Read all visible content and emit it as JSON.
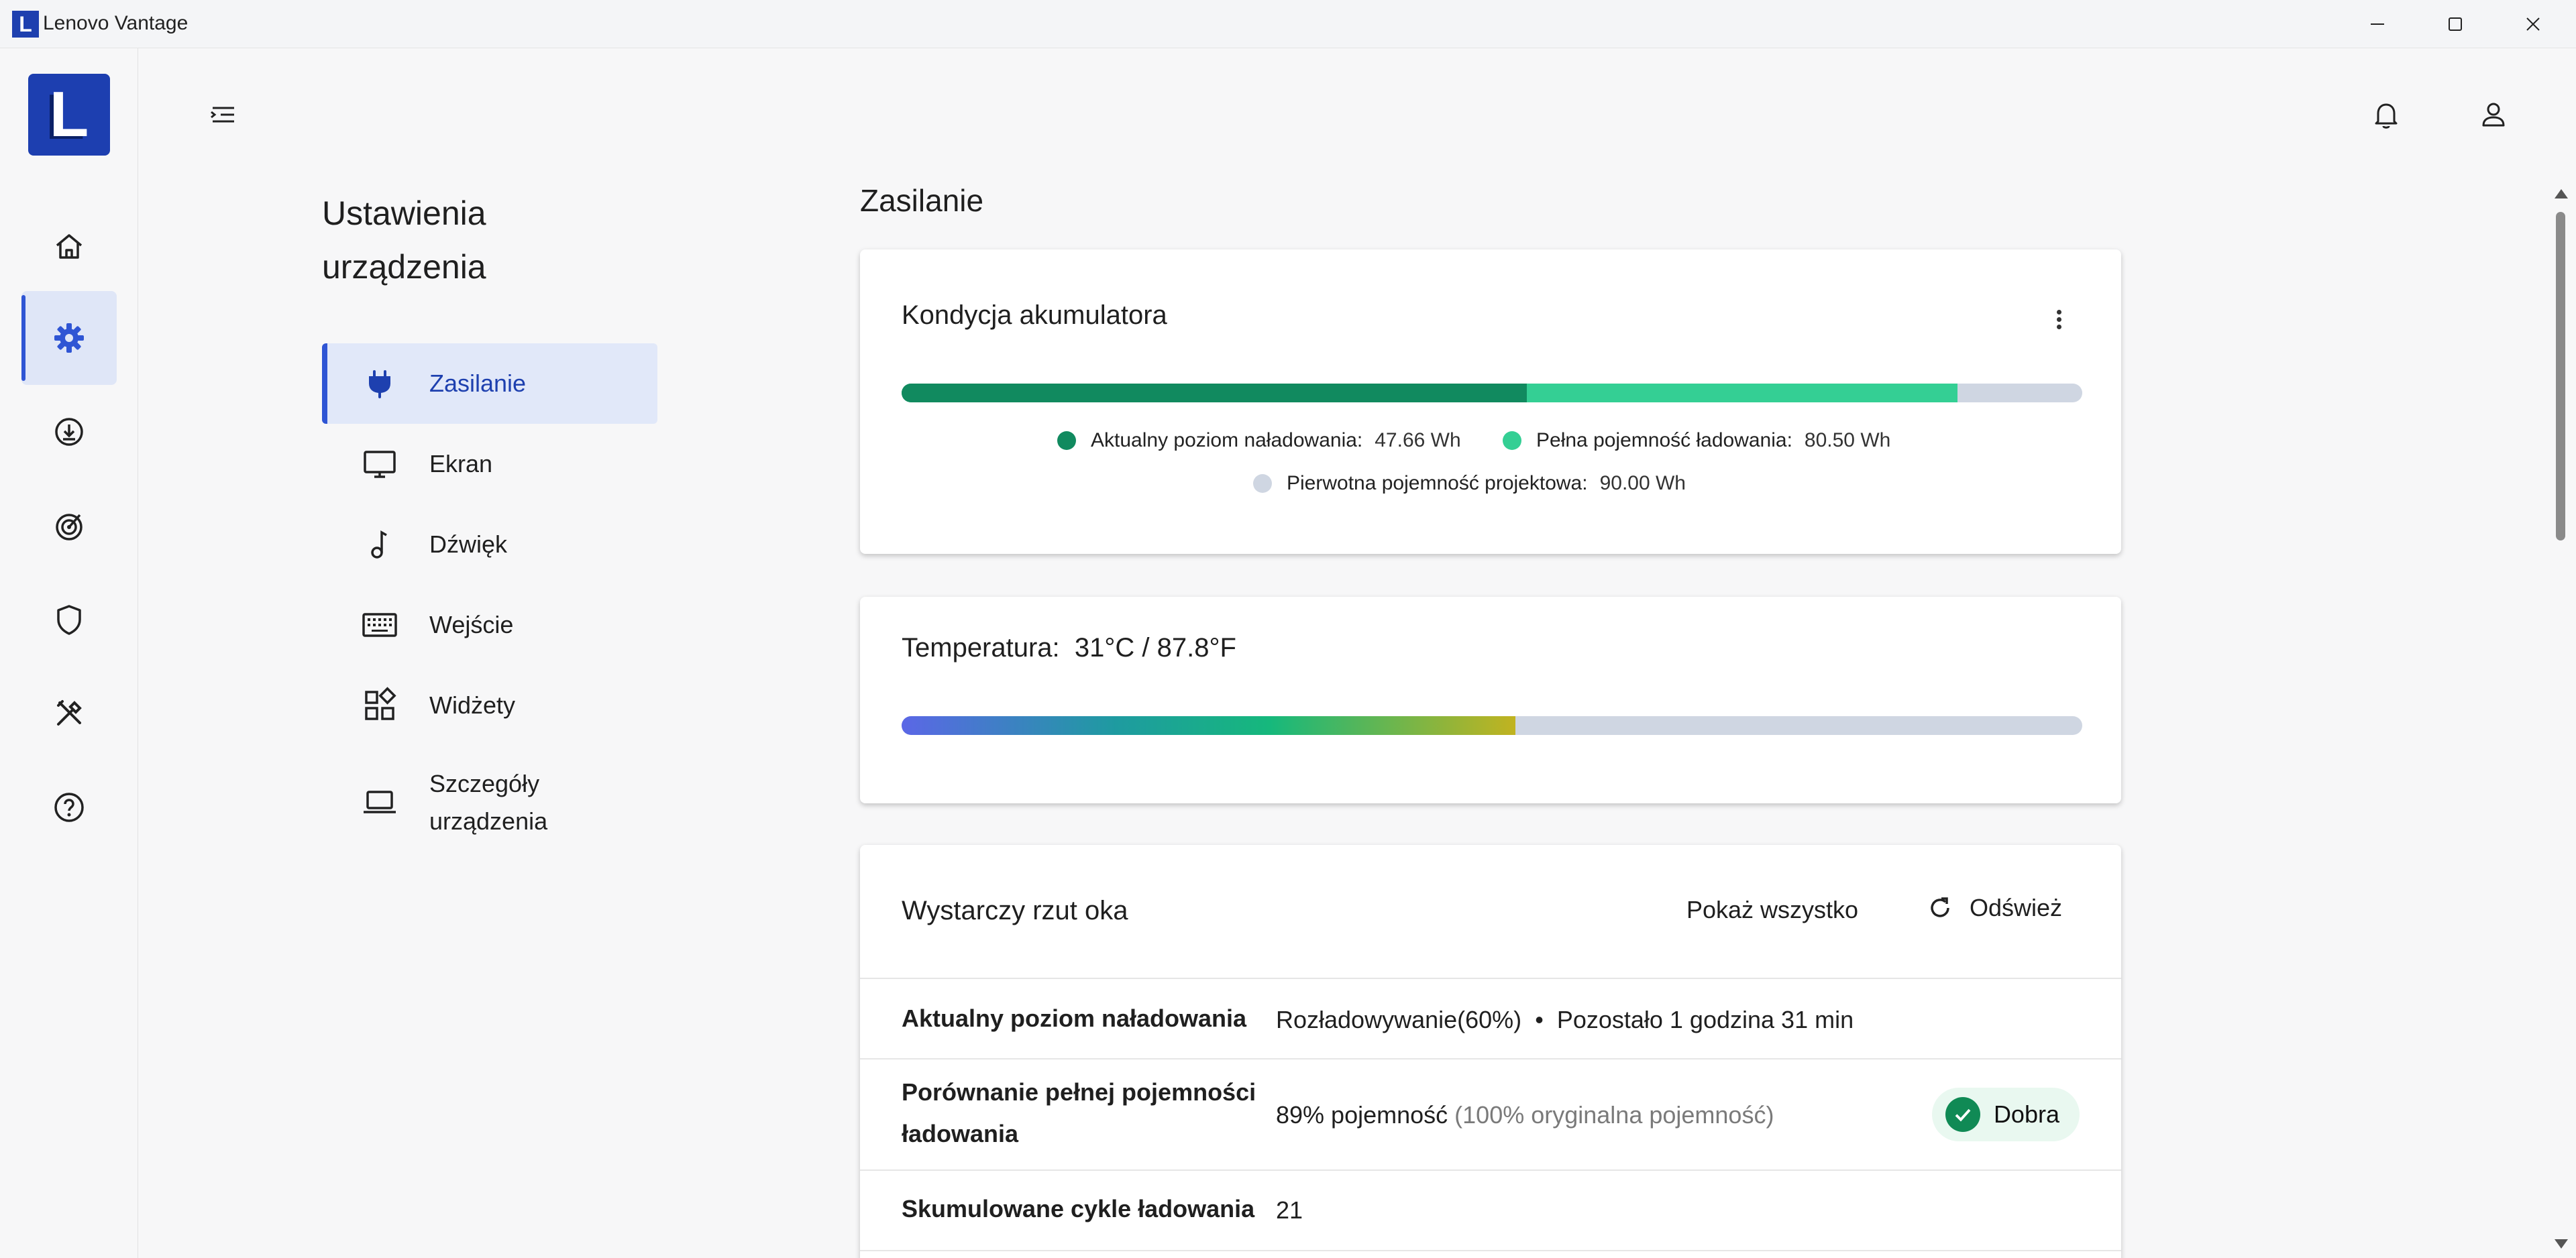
{
  "window": {
    "icon_letter": "L",
    "title": "Lenovo Vantage"
  },
  "rail": {
    "logo_letter": "L",
    "items": [
      {
        "icon": "home-icon"
      },
      {
        "icon": "gear-icon",
        "active": true
      },
      {
        "icon": "download-icon"
      },
      {
        "icon": "target-icon"
      },
      {
        "icon": "shield-icon"
      },
      {
        "icon": "tools-icon"
      },
      {
        "icon": "help-icon"
      }
    ]
  },
  "settings_nav": {
    "title": "Ustawienia urządzenia",
    "items": [
      {
        "label": "Zasilanie",
        "icon": "plug-icon",
        "active": true
      },
      {
        "label": "Ekran",
        "icon": "monitor-icon"
      },
      {
        "label": "Dźwięk",
        "icon": "music-note-icon"
      },
      {
        "label": "Wejście",
        "icon": "keyboard-icon"
      },
      {
        "label": "Widżety",
        "icon": "widgets-icon"
      },
      {
        "label": "Szczegóły urządzenia",
        "icon": "laptop-icon"
      }
    ]
  },
  "main": {
    "section_title": "Zasilanie",
    "battery_card": {
      "title": "Kondycja akumulatora",
      "current_fraction": 0.5295,
      "full_fraction": 0.8944,
      "legend": [
        {
          "label": "Aktualny poziom naładowania:",
          "value": "47.66 Wh",
          "color": "#118a5f"
        },
        {
          "label": "Pełna pojemność ładowania:",
          "value": "80.50 Wh",
          "color": "#34cf94"
        },
        {
          "label": "Pierwotna pojemność projektowa:",
          "value": "90.00 Wh",
          "color": "#cfd6e2"
        }
      ]
    },
    "temperature_card": {
      "label": "Temperatura:",
      "value": "31°C / 87.8°F",
      "fraction": 0.52
    },
    "glance_card": {
      "title": "Wystarczy rzut oka",
      "show_all": "Pokaż wszystko",
      "refresh": "Odśwież",
      "rows": [
        {
          "label": "Aktualny poziom naładowania",
          "value": "Rozładowywanie(60%)",
          "separator": "•",
          "value2": "Pozostało 1 godzina 31 min"
        },
        {
          "label": "Porównanie pełnej pojemności ładowania",
          "value": "89% pojemność",
          "value_muted": "(100% oryginalna pojemność)",
          "badge": "Dobra"
        },
        {
          "label": "Skumulowane cykle ładowania",
          "value": "21"
        }
      ]
    }
  },
  "colors": {
    "accent": "#2f55d4",
    "brand": "#1d3fb0",
    "good": "#108a55"
  }
}
